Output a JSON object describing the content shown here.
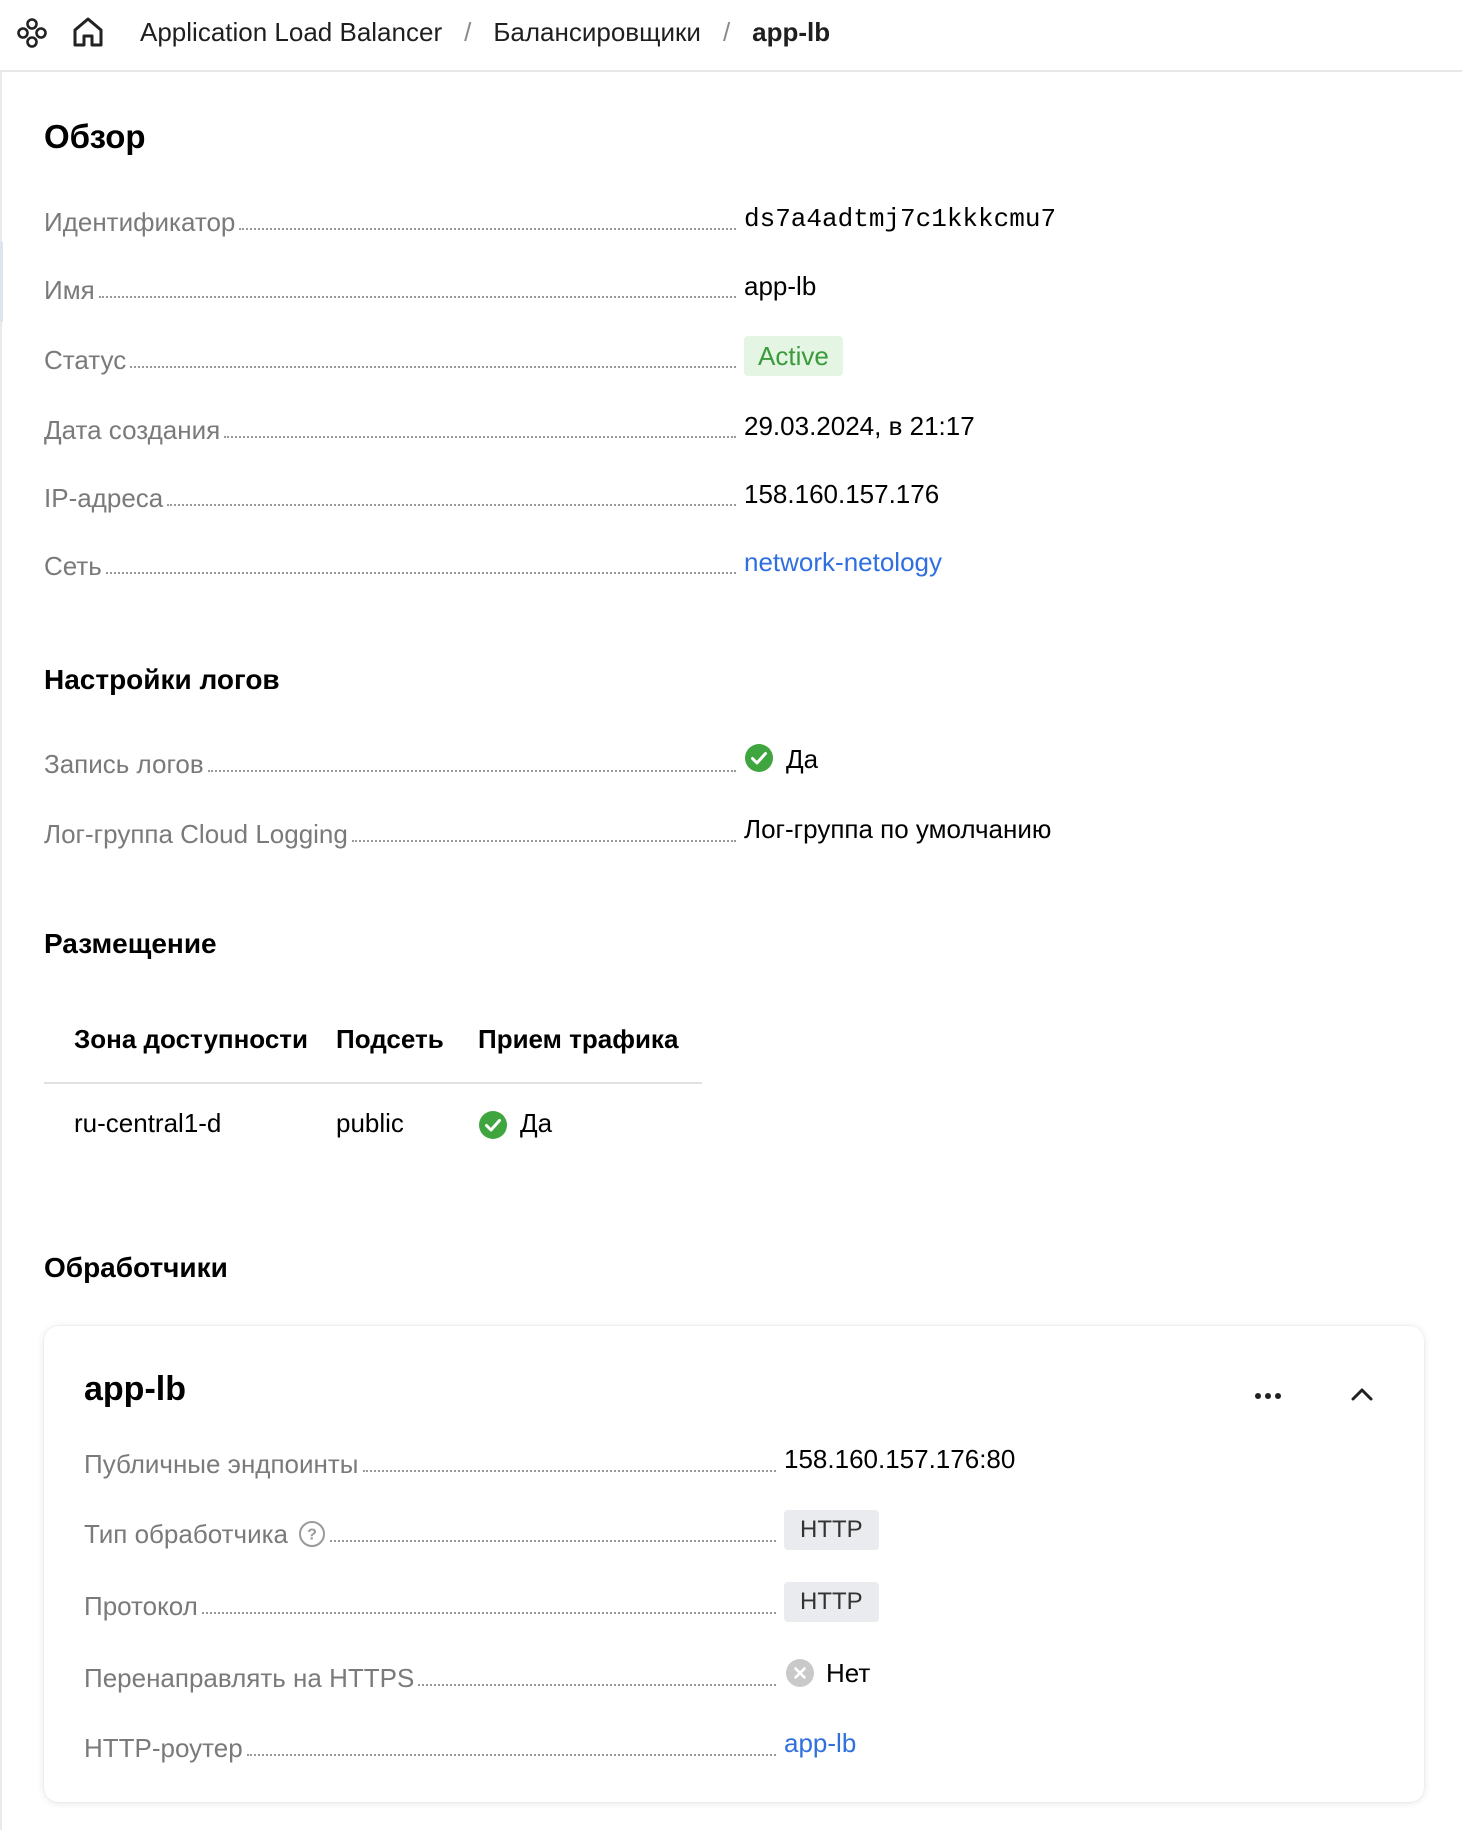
{
  "breadcrumb": {
    "items": [
      "Application Load Balancer",
      "Балансировщики",
      "app-lb"
    ],
    "separator": "/"
  },
  "overview": {
    "title": "Обзор",
    "rows": [
      {
        "label": "Идентификатор",
        "value": "ds7a4adtmj7c1kkkcmu7"
      },
      {
        "label": "Имя",
        "value": "app-lb"
      },
      {
        "label": "Статус",
        "value": "Active"
      },
      {
        "label": "Дата создания",
        "value": "29.03.2024, в 21:17"
      },
      {
        "label": "IP-адреса",
        "value": "158.160.157.176"
      },
      {
        "label": "Сеть",
        "value": "network-netology"
      }
    ]
  },
  "logs": {
    "title": "Настройки логов",
    "rows": [
      {
        "label": "Запись логов",
        "value": "Да"
      },
      {
        "label": "Лог-группа Cloud Logging",
        "value": "Лог-группа по умолчанию"
      }
    ]
  },
  "placement": {
    "title": "Размещение",
    "columns": [
      "Зона доступности",
      "Подсеть",
      "Прием трафика"
    ],
    "rows": [
      {
        "zone": "ru-central1-d",
        "subnet": "public",
        "traffic": "Да"
      }
    ]
  },
  "listeners": {
    "title": "Обработчики",
    "card": {
      "name": "app-lb",
      "rows": [
        {
          "label": "Публичные эндпоинты",
          "value": "158.160.157.176:80"
        },
        {
          "label": "Тип обработчика",
          "value": "HTTP"
        },
        {
          "label": "Протокол",
          "value": "HTTP"
        },
        {
          "label": "Перенаправлять на HTTPS",
          "value": "Нет"
        },
        {
          "label": "HTTP-роутер",
          "value": "app-lb"
        }
      ]
    }
  },
  "colors": {
    "link": "#2f6fe0",
    "success": "#3fa63f",
    "active_badge_bg": "#e4f5e4",
    "muted_label": "#7a7a7a"
  },
  "icons": [
    "services-icon",
    "home-icon",
    "check-circle-icon",
    "x-circle-icon",
    "help-icon",
    "more-icon",
    "chevron-up-icon"
  ]
}
